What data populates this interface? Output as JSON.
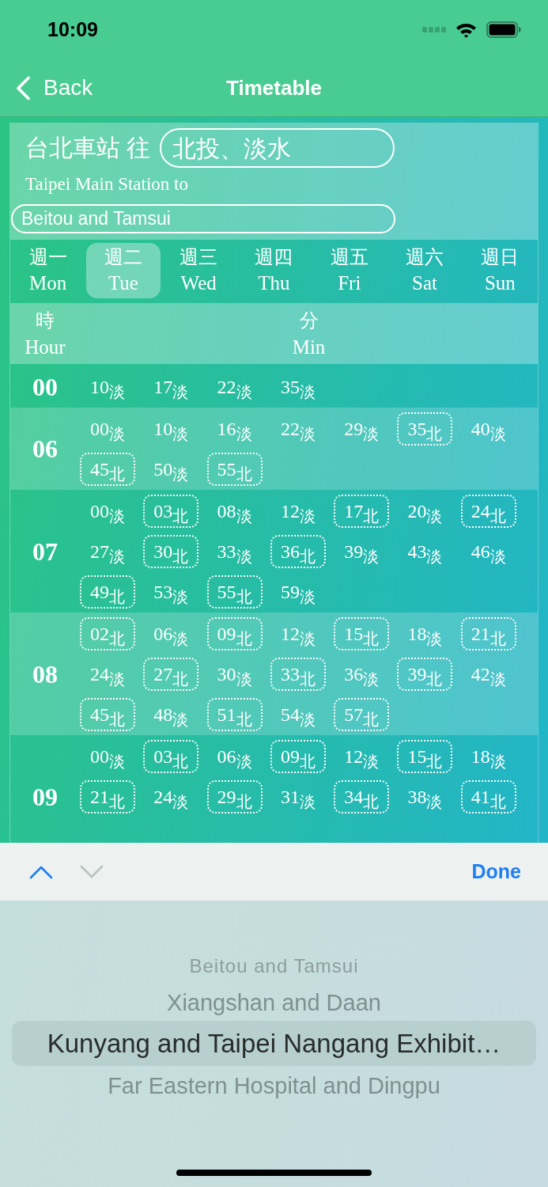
{
  "status_bar": {
    "time": "10:09"
  },
  "nav": {
    "back": "Back",
    "title": "Timetable"
  },
  "header": {
    "station_zh": "台北車站 往",
    "destination_zh": "北投、淡水",
    "station_en": "Taipei Main Station to",
    "destination_en": "Beitou and Tamsui"
  },
  "days": [
    {
      "zh": "週一",
      "en": "Mon",
      "selected": false
    },
    {
      "zh": "週二",
      "en": "Tue",
      "selected": true
    },
    {
      "zh": "週三",
      "en": "Wed",
      "selected": false
    },
    {
      "zh": "週四",
      "en": "Thu",
      "selected": false
    },
    {
      "zh": "週五",
      "en": "Fri",
      "selected": false
    },
    {
      "zh": "週六",
      "en": "Sat",
      "selected": false
    },
    {
      "zh": "週日",
      "en": "Sun",
      "selected": false
    }
  ],
  "columns": {
    "hour_zh": "時",
    "hour_en": "Hour",
    "minute_zh": "分",
    "minute_en": "Min"
  },
  "hours": [
    {
      "hour": "00",
      "departures": [
        {
          "time": "10$_{淡}$",
          "boxed": false
        },
        {
          "time": "17$_{淡}$",
          "boxed": false
        },
        {
          "time": "22$_{淡}$",
          "boxed": false
        },
        {
          "time": "35$_{淡}$",
          "boxed": false
        }
      ]
    },
    {
      "hour": "06",
      "departures": [
        {
          "time": "00$_{淡}$",
          "boxed": false
        },
        {
          "time": "10$_{淡}$",
          "boxed": false
        },
        {
          "time": "16$_{淡}$",
          "boxed": false
        },
        {
          "time": "22$_{淡}$",
          "boxed": false
        },
        {
          "time": "29$_{淡}$",
          "boxed": false
        },
        {
          "time": "35$_{北}$",
          "boxed": true
        },
        {
          "time": "40$_{淡}$",
          "boxed": false
        },
        {
          "time": "45$_{北}$",
          "boxed": true
        },
        {
          "time": "50$_{淡}$",
          "boxed": false
        },
        {
          "time": "55$_{北}$",
          "boxed": true
        }
      ]
    },
    {
      "hour": "07",
      "departures": [
        {
          "time": "00$_{淡}$",
          "boxed": false
        },
        {
          "time": "03$_{北}$",
          "boxed": true
        },
        {
          "time": "08$_{淡}$",
          "boxed": false
        },
        {
          "time": "12$_{淡}$",
          "boxed": false
        },
        {
          "time": "17$_{北}$",
          "boxed": true
        },
        {
          "time": "20$_{淡}$",
          "boxed": false
        },
        {
          "time": "24$_{北}$",
          "boxed": true
        },
        {
          "time": "27$_{淡}$",
          "boxed": false
        },
        {
          "time": "30$_{北}$",
          "boxed": true
        },
        {
          "time": "33$_{淡}$",
          "boxed": false
        },
        {
          "time": "36$_{北}$",
          "boxed": true
        },
        {
          "time": "39$_{淡}$",
          "boxed": false
        },
        {
          "time": "43$_{淡}$",
          "boxed": false
        },
        {
          "time": "46$_{淡}$",
          "boxed": false
        },
        {
          "time": "49$_{北}$",
          "boxed": true
        },
        {
          "time": "53$_{淡}$",
          "boxed": false
        },
        {
          "time": "55$_{北}$",
          "boxed": true
        },
        {
          "time": "59$_{淡}$",
          "boxed": false
        }
      ]
    },
    {
      "hour": "08",
      "departures": [
        {
          "time": "02$_{北}$",
          "boxed": true
        },
        {
          "time": "06$_{淡}$",
          "boxed": false
        },
        {
          "time": "09$_{北}$",
          "boxed": true
        },
        {
          "time": "12$_{淡}$",
          "boxed": false
        },
        {
          "time": "15$_{北}$",
          "boxed": true
        },
        {
          "time": "18$_{淡}$",
          "boxed": false
        },
        {
          "time": "21$_{北}$",
          "boxed": true
        },
        {
          "time": "24$_{淡}$",
          "boxed": false
        },
        {
          "time": "27$_{北}$",
          "boxed": true
        },
        {
          "time": "30$_{淡}$",
          "boxed": false
        },
        {
          "time": "33$_{北}$",
          "boxed": true
        },
        {
          "time": "36$_{淡}$",
          "boxed": false
        },
        {
          "time": "39$_{北}$",
          "boxed": true
        },
        {
          "time": "42$_{淡}$",
          "boxed": false
        },
        {
          "time": "45$_{北}$",
          "boxed": true
        },
        {
          "time": "48$_{淡}$",
          "boxed": false
        },
        {
          "time": "51$_{北}$",
          "boxed": true
        },
        {
          "time": "54$_{淡}$",
          "boxed": false
        },
        {
          "time": "57$_{北}$",
          "boxed": true
        }
      ]
    },
    {
      "hour": "09",
      "departures": [
        {
          "time": "00$_{淡}$",
          "boxed": false
        },
        {
          "time": "03$_{北}$",
          "boxed": true
        },
        {
          "time": "06$_{淡}$",
          "boxed": false
        },
        {
          "time": "09$_{北}$",
          "boxed": true
        },
        {
          "time": "12$_{淡}$",
          "boxed": false
        },
        {
          "time": "15$_{北}$",
          "boxed": true
        },
        {
          "time": "18$_{淡}$",
          "boxed": false
        },
        {
          "time": "21$_{北}$",
          "boxed": true
        },
        {
          "time": "24$_{淡}$",
          "boxed": false
        },
        {
          "time": "29$_{北}$",
          "boxed": true
        },
        {
          "time": "31$_{淡}$",
          "boxed": false
        },
        {
          "time": "34$_{北}$",
          "boxed": true
        },
        {
          "time": "38$_{淡}$",
          "boxed": false
        },
        {
          "time": "41$_{北}$",
          "boxed": true
        }
      ]
    }
  ],
  "toolbar": {
    "buttons": [
      {
        "kind": "previous",
        "disabled": false
      },
      {
        "kind": "next",
        "disabled": true
      }
    ],
    "done": "Done"
  },
  "picker": {
    "options": [
      {
        "label": "Beitou and Tamsui",
        "selected": false
      },
      {
        "label": "Xiangshan and Daan",
        "selected": false
      },
      {
        "label": "Kunyang and Taipei Nangang Exhibit…",
        "selected": true
      },
      {
        "label": "Far Eastern Hospital and Dingpu",
        "selected": false
      }
    ]
  }
}
